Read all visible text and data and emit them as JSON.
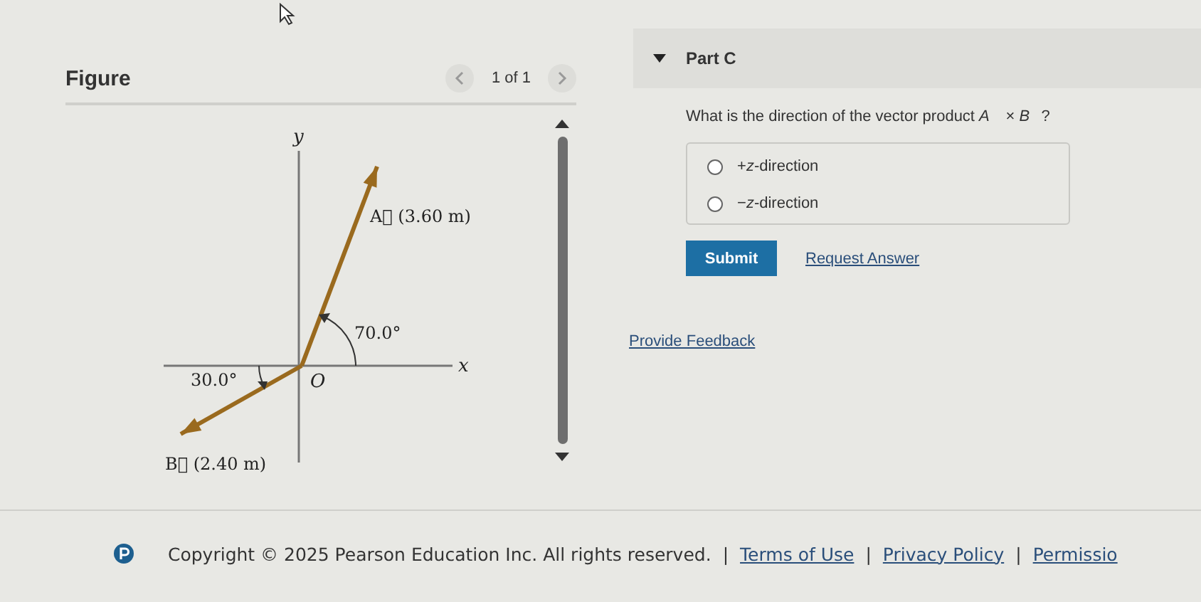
{
  "figure": {
    "title": "Figure",
    "page": "1 of 1",
    "diagram": {
      "y_axis": "y",
      "x_axis": "x",
      "origin": "O",
      "vector_a": "A⃗ (3.60 m)",
      "vector_b": "B⃗ (2.40 m)",
      "angle_a": "70.0°",
      "angle_b": "30.0°"
    }
  },
  "part": {
    "title": "Part C",
    "expanded": true,
    "question": "What is the direction of the vector product *A⃗* × *B⃗*?",
    "options": [
      {
        "label": "+*z*-direction",
        "selected": false
      },
      {
        "label": "−*z*-direction",
        "selected": false
      }
    ],
    "submit": "Submit",
    "request_answer": "Request Answer"
  },
  "feedback": "Provide Feedback",
  "footer": {
    "copyright": "Copyright © 2025  Pearson Education Inc. All rights reserved.",
    "links": [
      {
        "separator": "|",
        "label": "Terms of Use"
      },
      {
        "separator": "|",
        "label": "Privacy Policy"
      },
      {
        "separator": "|",
        "label": "Permissio"
      }
    ]
  }
}
